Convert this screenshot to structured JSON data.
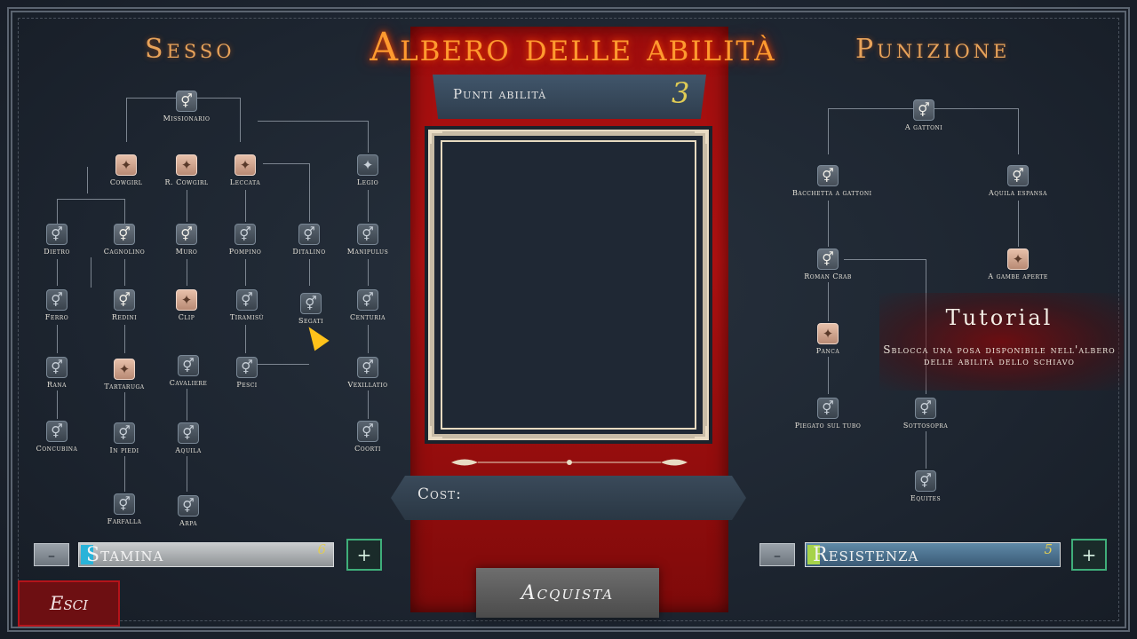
{
  "header": {
    "left_tab": "Sesso",
    "title": "Albero delle abilità",
    "right_tab": "Punizione"
  },
  "points": {
    "label": "Punti abilità",
    "value": "3"
  },
  "cost": {
    "label": "Cost:"
  },
  "buy_button": "Acquista",
  "exit_button": "Esci",
  "left_tree": [
    {
      "label": "Missionario",
      "icon": "gender-icon",
      "state": "locked"
    },
    {
      "label": "Cowgirl",
      "icon": "pose-icon",
      "state": "unlocked"
    },
    {
      "label": "R. Cowgirl",
      "icon": "pose-icon",
      "state": "unlocked"
    },
    {
      "label": "Leccata",
      "icon": "pose-icon",
      "state": "unlocked"
    },
    {
      "label": "Legio",
      "icon": "pose-icon",
      "state": "locked"
    },
    {
      "label": "Dietro",
      "icon": "gender-icon",
      "state": "locked"
    },
    {
      "label": "Cagnolino",
      "icon": "gender-icon",
      "state": "locked"
    },
    {
      "label": "Muro",
      "icon": "gender-icon",
      "state": "locked"
    },
    {
      "label": "Pompino",
      "icon": "gender-icon",
      "state": "locked"
    },
    {
      "label": "Ditalino",
      "icon": "gender-icon",
      "state": "locked"
    },
    {
      "label": "Manipulus",
      "icon": "gender-icon",
      "state": "locked"
    },
    {
      "label": "Ferro",
      "icon": "gender-icon",
      "state": "locked"
    },
    {
      "label": "Redini",
      "icon": "gender-icon",
      "state": "locked"
    },
    {
      "label": "Clip",
      "icon": "pose-icon",
      "state": "unlocked"
    },
    {
      "label": "Tiramisù",
      "icon": "gender-icon",
      "state": "locked"
    },
    {
      "label": "Segati",
      "icon": "gender-icon",
      "state": "locked"
    },
    {
      "label": "Centuria",
      "icon": "gender-icon",
      "state": "locked"
    },
    {
      "label": "Rana",
      "icon": "gender-icon",
      "state": "locked"
    },
    {
      "label": "Tartaruga",
      "icon": "pose-icon",
      "state": "unlocked"
    },
    {
      "label": "Cavaliere",
      "icon": "gender-icon",
      "state": "locked"
    },
    {
      "label": "Pesci",
      "icon": "gender-icon",
      "state": "locked"
    },
    {
      "label": "Vexillatio",
      "icon": "gender-icon",
      "state": "locked"
    },
    {
      "label": "Concubina",
      "icon": "gender-icon",
      "state": "locked"
    },
    {
      "label": "In piedi",
      "icon": "gender-icon",
      "state": "locked"
    },
    {
      "label": "Aquila",
      "icon": "gender-icon",
      "state": "locked"
    },
    {
      "label": "Coorti",
      "icon": "gender-icon",
      "state": "locked"
    },
    {
      "label": "Farfalla",
      "icon": "gender-icon",
      "state": "locked"
    },
    {
      "label": "Arpa",
      "icon": "gender-icon",
      "state": "locked"
    }
  ],
  "right_tree": [
    {
      "label": "A gattoni",
      "icon": "gender-icon",
      "state": "locked"
    },
    {
      "label": "Bacchetta a gattoni",
      "icon": "gender-icon",
      "state": "locked"
    },
    {
      "label": "Aquila espansa",
      "icon": "gender-icon",
      "state": "locked"
    },
    {
      "label": "Roman Crab",
      "icon": "gender-icon",
      "state": "locked"
    },
    {
      "label": "A gambe aperte",
      "icon": "pose-icon",
      "state": "unlocked"
    },
    {
      "label": "Panca",
      "icon": "pose-icon",
      "state": "unlocked"
    },
    {
      "label": "Piegato sul tubo",
      "icon": "gender-icon",
      "state": "locked"
    },
    {
      "label": "Sottosopra",
      "icon": "gender-icon",
      "state": "locked"
    },
    {
      "label": "Equites",
      "icon": "gender-icon",
      "state": "locked"
    }
  ],
  "tutorial": {
    "title": "Tutorial",
    "body": "Sblocca una posa disponibile nell'albero delle abilità dello schiavo"
  },
  "stats": {
    "left": {
      "name": "Stamina",
      "value": "6",
      "minus": "–",
      "plus": "+",
      "fill_color": "#29b3d9"
    },
    "right": {
      "name": "Resistenza",
      "value": "5",
      "minus": "–",
      "plus": "+",
      "fill_color": "#a6d34a"
    }
  },
  "colors": {
    "panel_red": "#b11111",
    "title_orange": "#ff9a2f",
    "background": "#1e2630"
  }
}
